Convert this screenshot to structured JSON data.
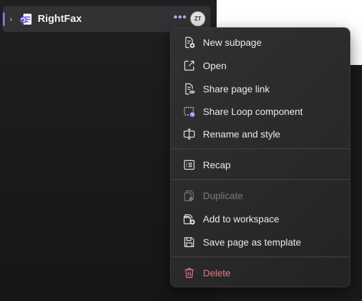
{
  "sidebar": {
    "page": {
      "title": "RightFax",
      "more_label": "•••",
      "avatar_initials": "ZT",
      "expand_glyph": "›"
    }
  },
  "context_menu": {
    "items": [
      {
        "label": "New subpage",
        "icon": "new-subpage-icon"
      },
      {
        "label": "Open",
        "icon": "open-external-icon"
      },
      {
        "label": "Share page link",
        "icon": "share-link-icon"
      },
      {
        "label": "Share Loop component",
        "icon": "loop-component-icon"
      },
      {
        "label": "Rename and style",
        "icon": "rename-icon"
      },
      {
        "label": "Recap",
        "icon": "recap-icon"
      },
      {
        "label": "Duplicate",
        "icon": "duplicate-icon",
        "disabled": true
      },
      {
        "label": "Add to workspace",
        "icon": "add-to-workspace-icon"
      },
      {
        "label": "Save page as template",
        "icon": "save-icon"
      },
      {
        "label": "Delete",
        "icon": "trash-icon",
        "danger": true
      }
    ]
  },
  "colors": {
    "accent": "#8d71e0",
    "danger": "#e87a80",
    "menu_bg": "#2c2c2e"
  }
}
